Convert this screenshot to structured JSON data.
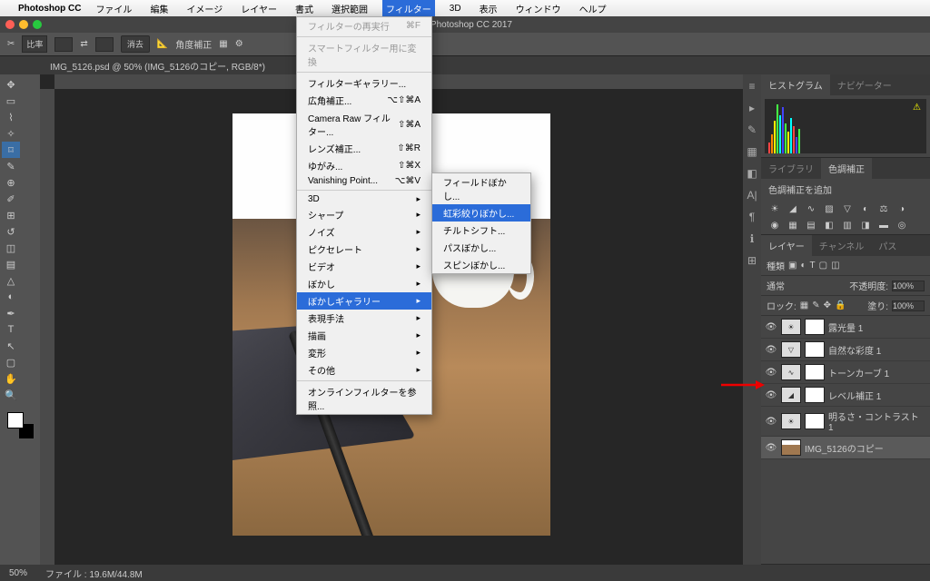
{
  "menubar": {
    "app": "Photoshop CC",
    "items": [
      "ファイル",
      "編集",
      "イメージ",
      "レイヤー",
      "書式",
      "選択範囲",
      "フィルター",
      "3D",
      "表示",
      "ウィンドウ",
      "ヘルプ"
    ],
    "active_index": 6
  },
  "titlebar": "be Photoshop CC 2017",
  "optbar": {
    "ratio_label": "比率",
    "clear_btn": "消去",
    "straighten": "角度補正"
  },
  "document_tab": "IMG_5126.psd @ 50% (IMG_5126のコピー, RGB/8*)",
  "filter_menu": {
    "items": [
      {
        "label": "フィルターの再実行",
        "shortcut": "⌘F",
        "dim": true
      },
      {
        "label": "スマートフィルター用に変換",
        "dim": true
      },
      {
        "sep": true
      },
      {
        "label": "フィルターギャラリー..."
      },
      {
        "label": "広角補正...",
        "shortcut": "⌥⇧⌘A"
      },
      {
        "label": "Camera Raw フィルター...",
        "shortcut": "⇧⌘A"
      },
      {
        "label": "レンズ補正...",
        "shortcut": "⇧⌘R"
      },
      {
        "label": "ゆがみ...",
        "shortcut": "⇧⌘X"
      },
      {
        "label": "Vanishing Point...",
        "shortcut": "⌥⌘V"
      },
      {
        "sep": true
      },
      {
        "label": "3D",
        "sub": true
      },
      {
        "label": "シャープ",
        "sub": true
      },
      {
        "label": "ノイズ",
        "sub": true
      },
      {
        "label": "ピクセレート",
        "sub": true
      },
      {
        "label": "ビデオ",
        "sub": true
      },
      {
        "label": "ぼかし",
        "sub": true
      },
      {
        "label": "ぼかしギャラリー",
        "sub": true,
        "hl": true
      },
      {
        "label": "表現手法",
        "sub": true
      },
      {
        "label": "描画",
        "sub": true
      },
      {
        "label": "変形",
        "sub": true
      },
      {
        "label": "その他",
        "sub": true
      },
      {
        "sep": true
      },
      {
        "label": "オンラインフィルターを参照..."
      }
    ]
  },
  "blur_submenu": [
    "フィールドぼかし...",
    "虹彩絞りぼかし...",
    "チルトシフト...",
    "パスぼかし...",
    "スピンぼかし..."
  ],
  "blur_submenu_hl": 1,
  "panels": {
    "histogram_tab": "ヒストグラム",
    "navigator_tab": "ナビゲーター",
    "library_tab": "ライブラリ",
    "adjustments_tab": "色調補正",
    "add_adjustment": "色調補正を追加",
    "layers_tab": "レイヤー",
    "channels_tab": "チャンネル",
    "paths_tab": "パス",
    "kind_label": "種類",
    "blend_mode": "通常",
    "opacity_label": "不透明度:",
    "opacity_val": "100%",
    "lock_label": "ロック:",
    "fill_label": "塗り:",
    "fill_val": "100%",
    "layers": [
      {
        "name": "露光量 1"
      },
      {
        "name": "自然な彩度 1"
      },
      {
        "name": "トーンカーブ 1"
      },
      {
        "name": "レベル補正 1"
      },
      {
        "name": "明るさ・コントラスト 1"
      },
      {
        "name": "IMG_5126のコピー",
        "selected": true,
        "image": true
      }
    ]
  },
  "status": {
    "zoom": "50%",
    "filesize": "ファイル : 19.6M/44.8M"
  }
}
